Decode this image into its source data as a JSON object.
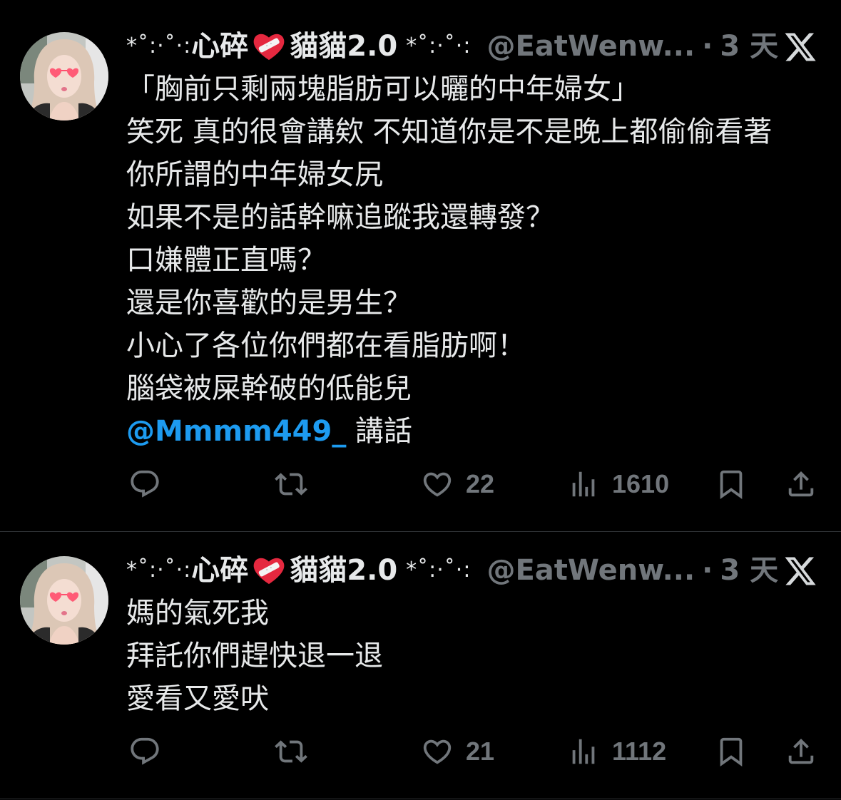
{
  "theme": {
    "background": "#000000",
    "text": "#e7e9ea",
    "muted": "#71767b",
    "link": "#1d9bf0",
    "divider": "#2f3336",
    "emoji_heart": "#e5283f"
  },
  "tweets": [
    {
      "author": {
        "decoration": "*˚:·˚·:",
        "name_before_emoji": "心碎",
        "emoji_icon": "mending-heart-icon",
        "name_after_emoji": "貓貓2.0",
        "decoration_end": "*˚:·˚·:",
        "handle": "@EatWenw...",
        "separator": "·",
        "time": "3 天"
      },
      "platform_icon": "x-logo-icon",
      "lines": [
        "「胸前只剩兩塊脂肪可以曬的中年婦女」",
        "笑死 真的很會講欸 不知道你是不是晚上都偷偷看著",
        "你所謂的中年婦女尻",
        "如果不是的話幹嘛追蹤我還轉發？",
        "口嫌體正直嗎？",
        "還是你喜歡的是男生？",
        "小心了各位你們都在看脂肪啊！",
        "腦袋被屎幹破的低能兒"
      ],
      "mention_line": {
        "mention": "@Mmmm449_",
        "text": " 講話"
      },
      "actions": {
        "reply": {
          "icon": "reply-icon"
        },
        "repost": {
          "icon": "repost-icon"
        },
        "like": {
          "icon": "heart-icon",
          "count": "22"
        },
        "views": {
          "icon": "views-icon",
          "count": "1610"
        },
        "bookmark": {
          "icon": "bookmark-icon"
        },
        "share": {
          "icon": "share-icon"
        }
      }
    },
    {
      "author": {
        "decoration": "*˚:·˚·:",
        "name_before_emoji": "心碎",
        "emoji_icon": "mending-heart-icon",
        "name_after_emoji": "貓貓2.0",
        "decoration_end": "*˚:·˚·:",
        "handle": "@EatWenw...",
        "separator": "·",
        "time": "3 天"
      },
      "platform_icon": "x-logo-icon",
      "lines": [
        "媽的氣死我",
        "拜託你們趕快退一退",
        "愛看又愛吠"
      ],
      "actions": {
        "reply": {
          "icon": "reply-icon"
        },
        "repost": {
          "icon": "repost-icon"
        },
        "like": {
          "icon": "heart-icon",
          "count": "21"
        },
        "views": {
          "icon": "views-icon",
          "count": "1112"
        },
        "bookmark": {
          "icon": "bookmark-icon"
        },
        "share": {
          "icon": "share-icon"
        }
      }
    }
  ]
}
